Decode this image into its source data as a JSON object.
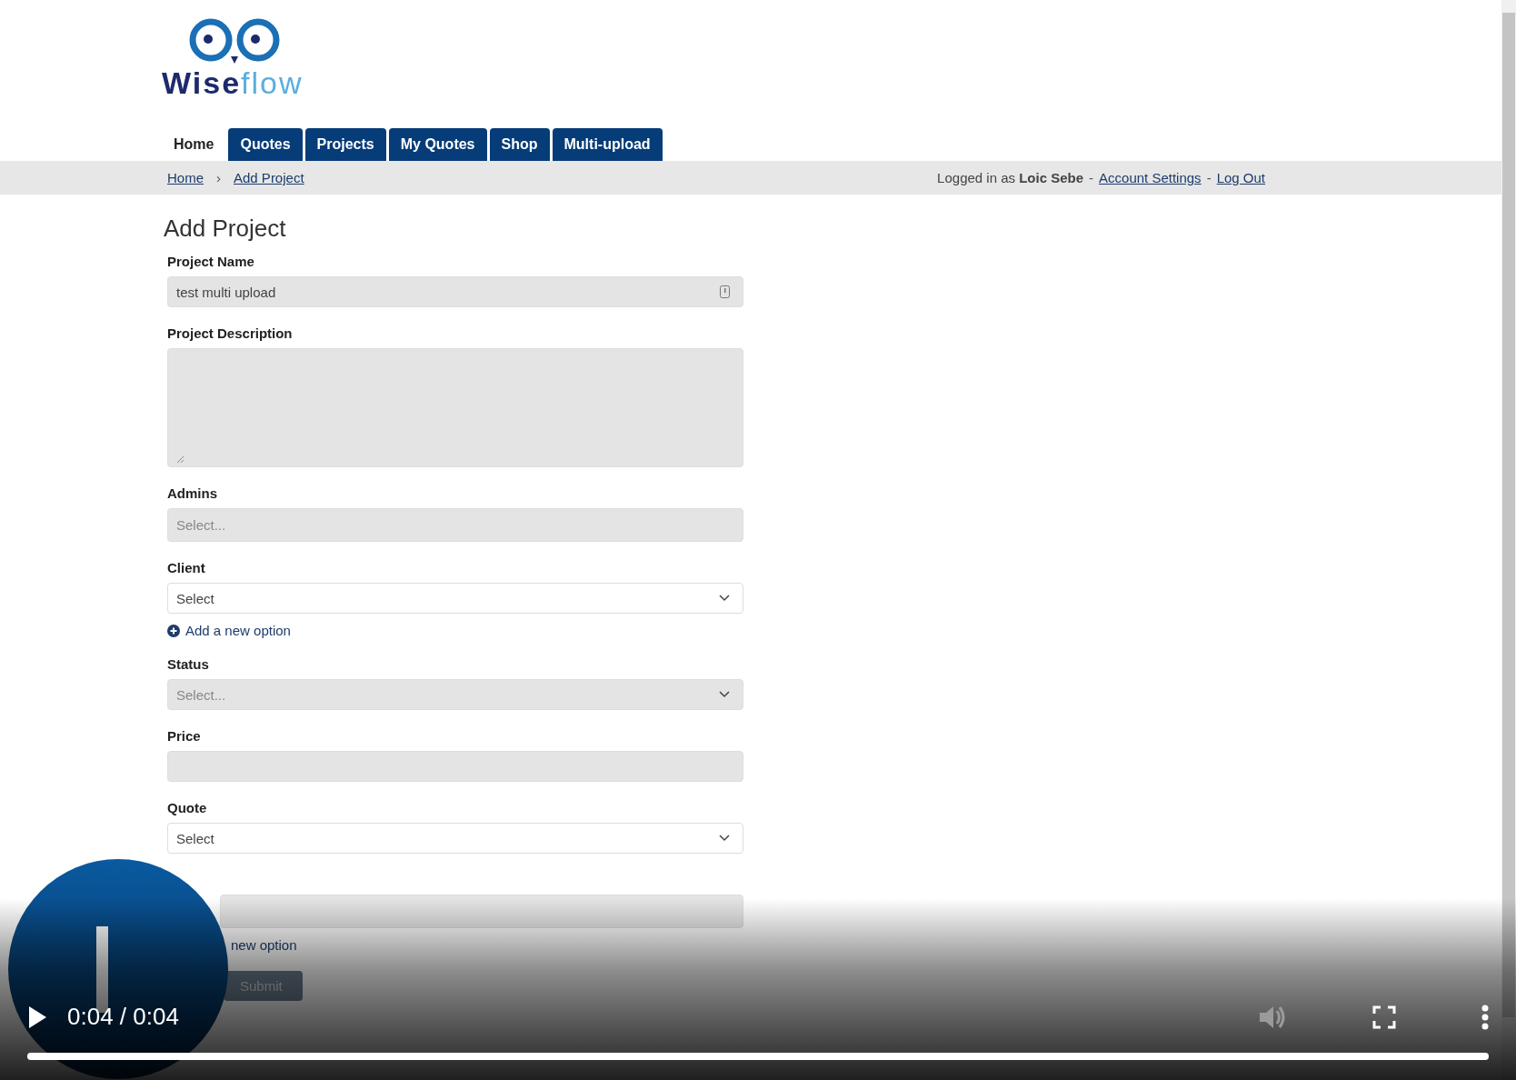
{
  "logo": {
    "text_dark": "Wise",
    "text_light": "flow"
  },
  "nav": {
    "tabs": [
      {
        "label": "Home",
        "selected": true
      },
      {
        "label": "Quotes",
        "selected": false
      },
      {
        "label": "Projects",
        "selected": false
      },
      {
        "label": "My Quotes",
        "selected": false
      },
      {
        "label": "Shop",
        "selected": false
      },
      {
        "label": "Multi-upload",
        "selected": false
      }
    ]
  },
  "breadcrumb": {
    "items": [
      "Home",
      "Add Project"
    ],
    "separator": "›"
  },
  "user_bar": {
    "prefix": "Logged in as",
    "user": "Loic Sebe",
    "separator": "-",
    "links": [
      "Account Settings",
      "Log Out"
    ]
  },
  "form": {
    "title": "Add Project",
    "fields": [
      {
        "kind": "input",
        "label": "Project Name",
        "value": "test multi upload",
        "shaded": true
      },
      {
        "kind": "textarea",
        "label": "Project Description",
        "shaded": true
      },
      {
        "kind": "multiselect",
        "label": "Admins",
        "placeholder": "Select...",
        "shaded": true
      },
      {
        "kind": "select",
        "label": "Client",
        "value": "Select",
        "shaded": false,
        "add_option": "Add a new option"
      },
      {
        "kind": "select",
        "label": "Status",
        "placeholder": "Select...",
        "shaded": true
      },
      {
        "kind": "input",
        "label": "Price",
        "shaded": true
      },
      {
        "kind": "select",
        "label": "Quote",
        "value": "Select",
        "shaded": false
      },
      {
        "kind": "multiselect",
        "shaded": true,
        "add_option": "new option",
        "covered": true
      }
    ],
    "submit": "Submit"
  },
  "video": {
    "time": "0:04 / 0:04",
    "progress": {
      "level": 1
    }
  }
}
